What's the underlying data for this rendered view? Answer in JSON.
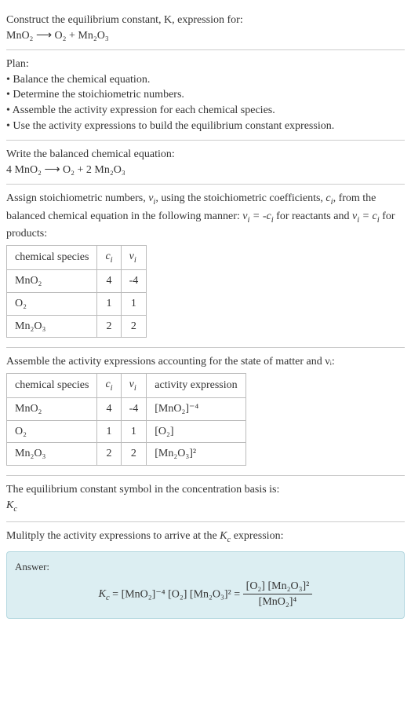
{
  "intro": {
    "line1": "Construct the equilibrium constant, K, expression for:",
    "equation": "MnO₂ ⟶ O₂ + Mn₂O₃"
  },
  "plan": {
    "heading": "Plan:",
    "b1": "• Balance the chemical equation.",
    "b2": "• Determine the stoichiometric numbers.",
    "b3": "• Assemble the activity expression for each chemical species.",
    "b4": "• Use the activity expressions to build the equilibrium constant expression."
  },
  "balanced": {
    "heading": "Write the balanced chemical equation:",
    "equation": "4 MnO₂ ⟶ O₂ + 2 Mn₂O₃"
  },
  "stoich": {
    "text1": "Assign stoichiometric numbers, ",
    "text2": ", using the stoichiometric coefficients, ",
    "text3": ", from the balanced chemical equation in the following manner: ",
    "text4": " for reactants and ",
    "text5": " for products:",
    "col1": "chemical species",
    "col2": "cᵢ",
    "col3": "νᵢ",
    "r1c1": "MnO₂",
    "r1c2": "4",
    "r1c3": "-4",
    "r2c1": "O₂",
    "r2c2": "1",
    "r2c3": "1",
    "r3c1": "Mn₂O₃",
    "r3c2": "2",
    "r3c3": "2"
  },
  "activity": {
    "heading": "Assemble the activity expressions accounting for the state of matter and νᵢ:",
    "col1": "chemical species",
    "col2": "cᵢ",
    "col3": "νᵢ",
    "col4": "activity expression",
    "r1c1": "MnO₂",
    "r1c2": "4",
    "r1c3": "-4",
    "r1c4": "[MnO₂]⁻⁴",
    "r2c1": "O₂",
    "r2c2": "1",
    "r2c3": "1",
    "r2c4": "[O₂]",
    "r3c1": "Mn₂O₃",
    "r3c2": "2",
    "r3c3": "2",
    "r3c4": "[Mn₂O₃]²"
  },
  "symbol": {
    "line1": "The equilibrium constant symbol in the concentration basis is:",
    "line2": "K_c"
  },
  "final": {
    "heading": "Mulitply the activity expressions to arrive at the K_c expression:",
    "answer_label": "Answer:",
    "lhs": "K_c = [MnO₂]⁻⁴ [O₂] [Mn₂O₃]² = ",
    "frac_num": "[O₂] [Mn₂O₃]²",
    "frac_den": "[MnO₂]⁴"
  }
}
